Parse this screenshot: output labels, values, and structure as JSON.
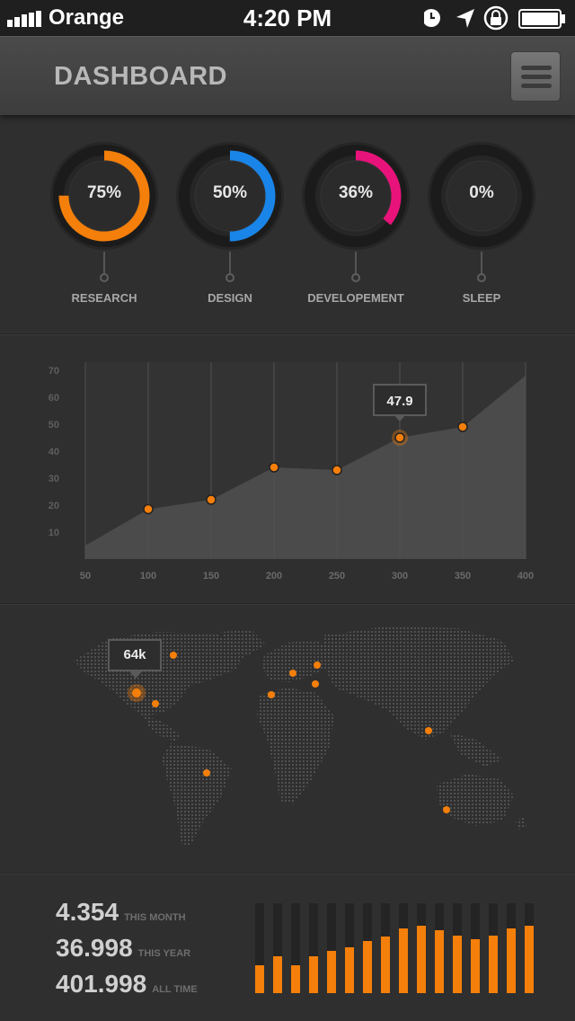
{
  "status_bar": {
    "carrier": "Orange",
    "time": "4:20 PM",
    "icons": [
      "signal-bars-icon",
      "alarm-clock-icon",
      "location-arrow-icon",
      "rotation-lock-icon",
      "battery-icon"
    ]
  },
  "header": {
    "title": "DASHBOARD",
    "menu_icon": "hamburger-menu-icon"
  },
  "rings": [
    {
      "value": "75%",
      "label": "RESEARCH",
      "fraction": 0.75,
      "color": "#f47f0a"
    },
    {
      "value": "50%",
      "label": "DESIGN",
      "fraction": 0.5,
      "color": "#1a85e8"
    },
    {
      "value": "36%",
      "label": "DEVELOPEMENT",
      "fraction": 0.36,
      "color": "#e8137a"
    },
    {
      "value": "0%",
      "label": "SLEEP",
      "fraction": 0.0,
      "color": "#f47f0a"
    }
  ],
  "chart_data": {
    "type": "area",
    "x_ticks": [
      "50",
      "100",
      "150",
      "200",
      "250",
      "300",
      "350",
      "400"
    ],
    "y_ticks": [
      "10",
      "20",
      "30",
      "40",
      "50",
      "60",
      "70"
    ],
    "xlim": [
      50,
      400
    ],
    "ylim": [
      0,
      73
    ],
    "x": [
      50,
      100,
      150,
      200,
      250,
      300,
      350,
      400
    ],
    "y": [
      5,
      18.5,
      22,
      34,
      33,
      45,
      49,
      68
    ],
    "marker_x": [
      100,
      150,
      200,
      250,
      300,
      350
    ],
    "highlight": {
      "x": 300,
      "label": "47.9"
    },
    "grid": "vertical",
    "colors": {
      "area": "#4b4b4b",
      "marker": "#f47f0a"
    }
  },
  "map": {
    "callout": "64k",
    "accent": "#f47f0a"
  },
  "stats": [
    {
      "value": "4.354",
      "label": "THIS MONTH"
    },
    {
      "value": "36.998",
      "label": "THIS YEAR"
    },
    {
      "value": "401.998",
      "label": "ALL TIME"
    }
  ],
  "bar_levels": [
    0.31,
    0.41,
    0.31,
    0.41,
    0.47,
    0.51,
    0.58,
    0.63,
    0.72,
    0.75,
    0.7,
    0.64,
    0.6,
    0.64,
    0.72,
    0.75
  ]
}
